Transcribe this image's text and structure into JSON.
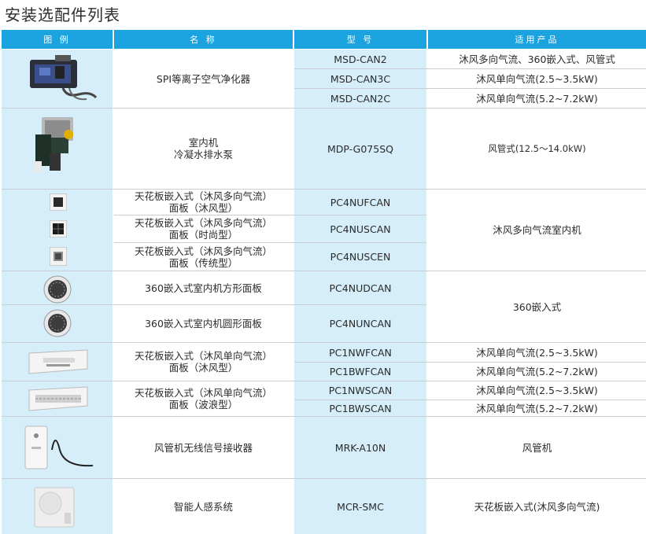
{
  "title": "安装选配件列表",
  "headers": [
    "图 例",
    "名 称",
    "型 号",
    "适用产品"
  ],
  "names": {
    "spi": "SPI等离子空气净化器",
    "pump_line1": "室内机",
    "pump_line2": "冷凝水排水泵",
    "p4a_l1": "天花板嵌入式（沐风多向气流）",
    "p4a_l2": "面板（沐风型）",
    "p4b_l1": "天花板嵌入式（沐风多向气流）",
    "p4b_l2": "面板（时尚型）",
    "p4c_l1": "天花板嵌入式（沐风多向气流）",
    "p4c_l2": "面板（传统型）",
    "p360a": "360嵌入式室内机方形面板",
    "p360b": "360嵌入式室内机圆形面板",
    "p1a_l1": "天花板嵌入式（沐风单向气流）",
    "p1a_l2": "面板（沐风型）",
    "p1b_l1": "天花板嵌入式（沐风单向气流）",
    "p1b_l2": "面板（波浪型）",
    "mrk": "风管机无线信号接收器",
    "mcr": "智能人感系统"
  },
  "models": {
    "m1": "MSD-CAN2",
    "m2": "MSD-CAN3C",
    "m3": "MSD-CAN2C",
    "m4": "MDP-G075SQ",
    "m5": "PC4NUFCAN",
    "m6": "PC4NUSCAN",
    "m7": "PC4NUSCEN",
    "m8": "PC4NUDCAN",
    "m9": "PC4NUNCAN",
    "m10": "PC1NWFCAN",
    "m11": "PC1BWFCAN",
    "m12": "PC1NWSCAN",
    "m13": "PC1BWSCAN",
    "m14": "MRK-A10N",
    "m15": "MCR-SMC"
  },
  "products": {
    "a1": "沐风多向气流、360嵌入式、风管式",
    "a2": "沐风单向气流(2.5~3.5kW)",
    "a3": "沐风单向气流(5.2~7.2kW)",
    "a4": "风管式(12.5～14.0kW)",
    "a5": "沐风多向气流室内机",
    "a6": "360嵌入式",
    "a7": "沐风单向气流(2.5~3.5kW)",
    "a8": "沐风单向气流(5.2~7.2kW)",
    "a9": "沐风单向气流(2.5~3.5kW)",
    "a10": "沐风单向气流(5.2~7.2kW)",
    "a11": "风管机",
    "a12": "天花板嵌入式(沐风多向气流)"
  },
  "colors": {
    "header": "#1aa3df",
    "light_blue": "#d5eefa",
    "line": "#c6cfd6"
  }
}
